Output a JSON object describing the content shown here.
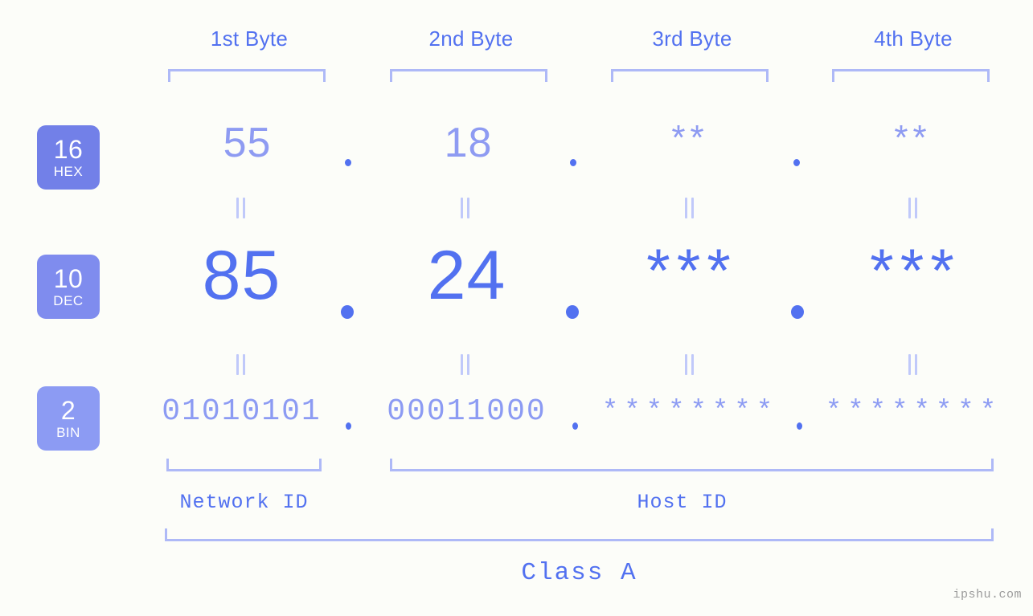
{
  "meta": {
    "background_color": "#fcfdf9",
    "accent_color": "#5271f0",
    "accent_light": "#8c9bf3",
    "bracket_color": "#aeb9f7"
  },
  "headers": {
    "bytes": [
      {
        "label": "1st Byte"
      },
      {
        "label": "2nd Byte"
      },
      {
        "label": "3rd Byte"
      },
      {
        "label": "4th Byte"
      }
    ]
  },
  "bases": [
    {
      "number": "16",
      "abbr": "HEX",
      "color": "#7280e8"
    },
    {
      "number": "10",
      "abbr": "DEC",
      "color": "#7f8cee"
    },
    {
      "number": "2",
      "abbr": "BIN",
      "color": "#8c9bf3"
    }
  ],
  "rows": {
    "hex": {
      "values": [
        "55",
        "18",
        "**",
        "**"
      ]
    },
    "dec": {
      "values": [
        "85",
        "24",
        "***",
        "***"
      ]
    },
    "bin": {
      "values": [
        "01010101",
        "00011000",
        "********",
        "********"
      ]
    }
  },
  "separators": {
    "dot": ".",
    "equals": "||"
  },
  "footer": {
    "network_id_label": "Network ID",
    "host_id_label": "Host ID",
    "class_label": "Class A",
    "watermark": "ipshu.com"
  }
}
